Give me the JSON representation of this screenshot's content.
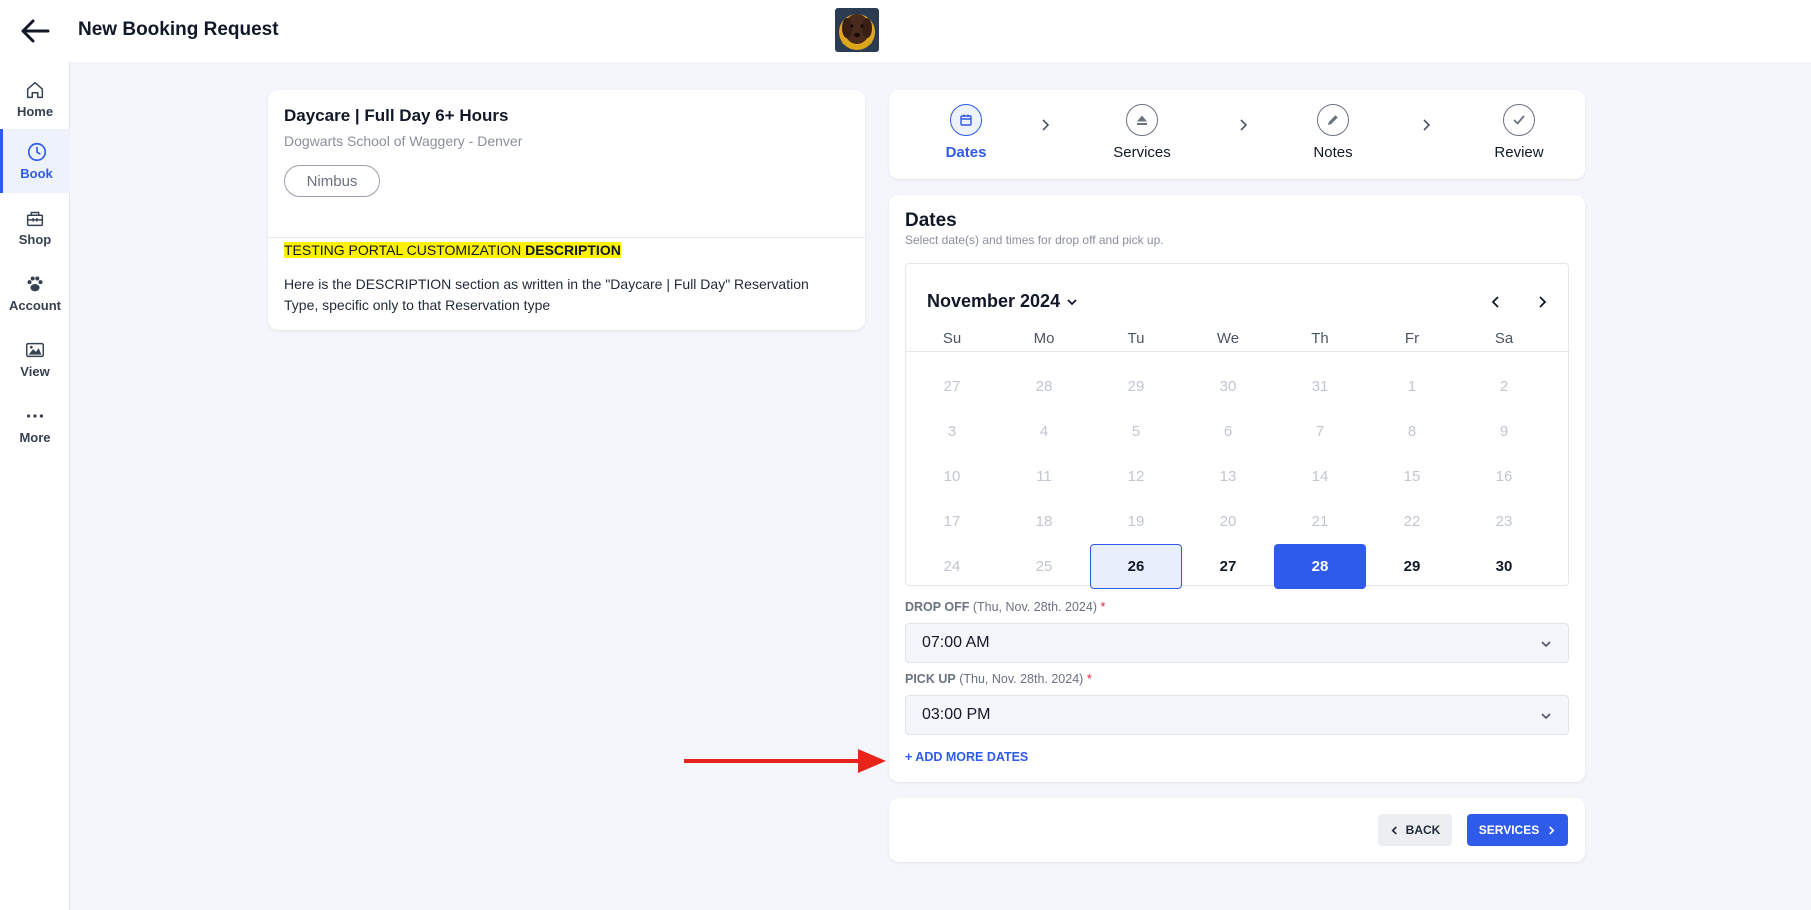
{
  "header": {
    "title": "New Booking Request",
    "avatar_icon": "dog-avatar-icon"
  },
  "sidebar": {
    "items": [
      {
        "label": "Home",
        "icon": "home-icon"
      },
      {
        "label": "Book",
        "icon": "clock-icon",
        "active": true
      },
      {
        "label": "Shop",
        "icon": "shop-icon"
      },
      {
        "label": "Account",
        "icon": "paw-icon"
      },
      {
        "label": "View",
        "icon": "image-icon"
      },
      {
        "label": "More",
        "icon": "more-icon"
      }
    ]
  },
  "service": {
    "title": "Daycare | Full Day 6+ Hours",
    "location": "Dogwarts School of Waggery - Denver",
    "pet": "Nimbus",
    "highlight_text": "TESTING PORTAL CUSTOMIZATION ",
    "highlight_bold": "DESCRIPTION",
    "description": "Here is the DESCRIPTION section as written in the \"Daycare | Full Day\" Reservation Type, specific only to that Reservation type"
  },
  "steps": [
    {
      "label": "Dates",
      "icon": "calendar-icon",
      "active": true
    },
    {
      "label": "Services",
      "icon": "eject-icon"
    },
    {
      "label": "Notes",
      "icon": "pencil-icon"
    },
    {
      "label": "Review",
      "icon": "check-icon"
    }
  ],
  "dates": {
    "title": "Dates",
    "subtitle": "Select date(s) and times for drop off and pick up.",
    "calendar": {
      "month": "November 2024",
      "weekdays": [
        "Su",
        "Mo",
        "Tu",
        "We",
        "Th",
        "Fr",
        "Sa"
      ],
      "weeks": [
        [
          "27",
          "28",
          "29",
          "30",
          "31",
          "1",
          "2"
        ],
        [
          "3",
          "4",
          "5",
          "6",
          "7",
          "8",
          "9"
        ],
        [
          "10",
          "11",
          "12",
          "13",
          "14",
          "15",
          "16"
        ],
        [
          "17",
          "18",
          "19",
          "20",
          "21",
          "22",
          "23"
        ],
        [
          "24",
          "25",
          "26",
          "27",
          "28",
          "29",
          "30"
        ]
      ],
      "available": [
        "26",
        "27",
        "28",
        "29",
        "30"
      ],
      "today": "26",
      "selected": "28"
    },
    "drop_off": {
      "label": "DROP OFF",
      "date": "(Thu, Nov. 28th. 2024)",
      "required": "*",
      "value": "07:00 AM"
    },
    "pick_up": {
      "label": "PICK UP",
      "date": "(Thu, Nov. 28th. 2024)",
      "required": "*",
      "value": "03:00 PM"
    },
    "add_more": "+ ADD MORE DATES"
  },
  "actions": {
    "back": "BACK",
    "next": "SERVICES"
  },
  "colors": {
    "accent": "#2f5bea",
    "highlight": "#fff200",
    "annotation_arrow": "#e8231a",
    "required": "#e11d48"
  }
}
